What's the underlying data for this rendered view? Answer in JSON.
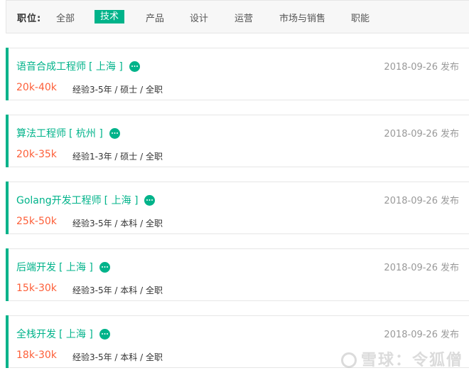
{
  "filter": {
    "label": "职位:",
    "items": [
      "全部",
      "技术",
      "产品",
      "设计",
      "运营",
      "市场与销售",
      "职能"
    ],
    "active_index": 1
  },
  "jobs": [
    {
      "title": "语音合成工程师",
      "city": "[ 上海 ]",
      "salary": "20k-40k",
      "requirements": "经验3-5年 / 硕士 / 全职",
      "date": "2018-09-26",
      "date_suffix": "发布"
    },
    {
      "title": "算法工程师",
      "city": "[ 杭州 ]",
      "salary": "20k-35k",
      "requirements": "经验1-3年 / 硕士 / 全职",
      "date": "2018-09-26",
      "date_suffix": "发布"
    },
    {
      "title": "Golang开发工程师",
      "city": "[ 上海 ]",
      "salary": "25k-50k",
      "requirements": "经验3-5年 / 本科 / 全职",
      "date": "2018-09-26",
      "date_suffix": "发布"
    },
    {
      "title": "后端开发",
      "city": "[ 上海 ]",
      "salary": "15k-30k",
      "requirements": "经验3-5年 / 本科 / 全职",
      "date": "2018-09-26",
      "date_suffix": "发布"
    },
    {
      "title": "全栈开发",
      "city": "[ 上海 ]",
      "salary": "18k-30k",
      "requirements": "经验3-5年 / 本科 / 全职",
      "date": "2018-09-26",
      "date_suffix": "发布"
    }
  ],
  "icons": {
    "chat": "chat-bubble-icon"
  },
  "colors": {
    "accent": "#00b38a",
    "salary": "#fd5f39"
  },
  "watermark": {
    "text": "雪球：令狐僧"
  }
}
